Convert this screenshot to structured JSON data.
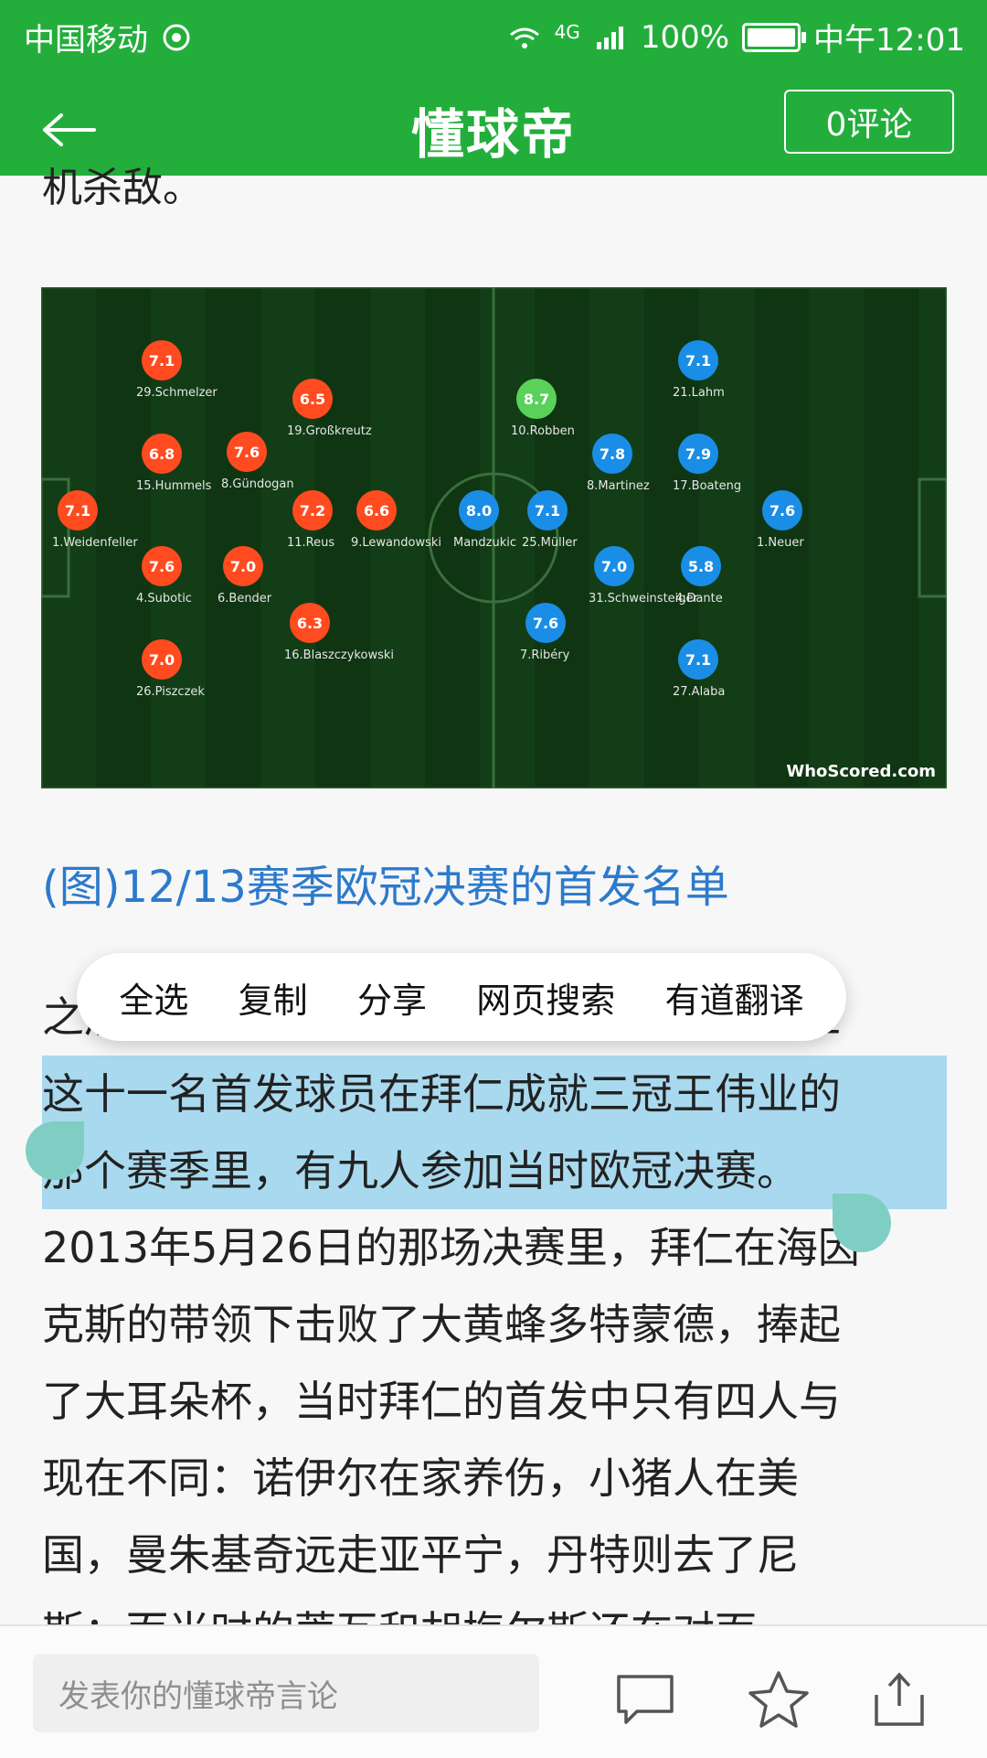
{
  "status_bar": {
    "carrier": "中国移动",
    "network": "4G",
    "battery": "100%",
    "time": "中午12:01"
  },
  "header": {
    "brand": "懂球帝",
    "comments_button": "0评论"
  },
  "article": {
    "top_fragment": "机杀敌。",
    "caption": "(图)12/13赛季欧冠决赛的首发名单",
    "lines": [
      "之后在拜仁成就三冠王伟业的那个赛季场上",
      "这十一名首发球员在拜仁成就三冠王伟业的",
      "那个赛季里，有九人参加当时欧冠决赛。",
      "2013年5月26日的那场决赛里，拜仁在海因",
      "克斯的带领下击败了大黄蜂多特蒙德，捧起",
      "了大耳朵杯，当时拜仁的首发中只有四人与",
      "现在不同：诺伊尔在家养伤，小猪人在美",
      "国，曼朱基奇远走亚平宁，丹特则去了尼",
      "斯；而当时的蒂瓦和胡梅尔斯还在对面"
    ]
  },
  "selection_menu": {
    "items": [
      "全选",
      "复制",
      "分享",
      "网页搜索",
      "有道翻译"
    ]
  },
  "bottom_bar": {
    "placeholder": "发表你的懂球帝言论"
  },
  "lineup_image": {
    "watermark": "WhoScored.com",
    "players": [
      {
        "name": "29.Schmelzer",
        "rating": "7.1",
        "team": "red"
      },
      {
        "name": "19.Großkreutz",
        "rating": "6.5",
        "team": "red"
      },
      {
        "name": "15.Hummels",
        "rating": "6.8",
        "team": "red"
      },
      {
        "name": "8.Gündogan",
        "rating": "7.6",
        "team": "red"
      },
      {
        "name": "1.Weidenfeller",
        "rating": "7.1",
        "team": "red"
      },
      {
        "name": "11.Reus",
        "rating": "7.2",
        "team": "red"
      },
      {
        "name": "9.Lewandowski",
        "rating": "6.6",
        "team": "red"
      },
      {
        "name": "4.Subotic",
        "rating": "7.6",
        "team": "red"
      },
      {
        "name": "6.Bender",
        "rating": "7.0",
        "team": "red"
      },
      {
        "name": "16.Blaszczykowski",
        "rating": "6.3",
        "team": "red"
      },
      {
        "name": "26.Piszczek",
        "rating": "7.0",
        "team": "red"
      },
      {
        "name": "10.Robben",
        "rating": "8.7",
        "team": "star"
      },
      {
        "name": "21.Lahm",
        "rating": "7.1",
        "team": "blue"
      },
      {
        "name": "8.Martinez",
        "rating": "7.8",
        "team": "blue"
      },
      {
        "name": "17.Boateng",
        "rating": "7.9",
        "team": "blue"
      },
      {
        "name": "Mandzukic",
        "rating": "8.0",
        "team": "blue"
      },
      {
        "name": "25.Müller",
        "rating": "7.1",
        "team": "blue"
      },
      {
        "name": "1.Neuer",
        "rating": "7.6",
        "team": "blue"
      },
      {
        "name": "31.Schweinsteiger",
        "rating": "7.0",
        "team": "blue"
      },
      {
        "name": "4.Dante",
        "rating": "5.8",
        "team": "blue"
      },
      {
        "name": "7.Ribéry",
        "rating": "7.6",
        "team": "blue"
      },
      {
        "name": "27.Alaba",
        "rating": "7.1",
        "team": "blue"
      }
    ]
  },
  "colors": {
    "header_green": "#23ae3c",
    "caption_blue": "#2c7acb",
    "selection_blue": "#a9d9ee",
    "handle_teal": "#7fcec3",
    "red_player": "#ff4b1f",
    "blue_player": "#1a8ee6",
    "star_player": "#5ad15a"
  }
}
